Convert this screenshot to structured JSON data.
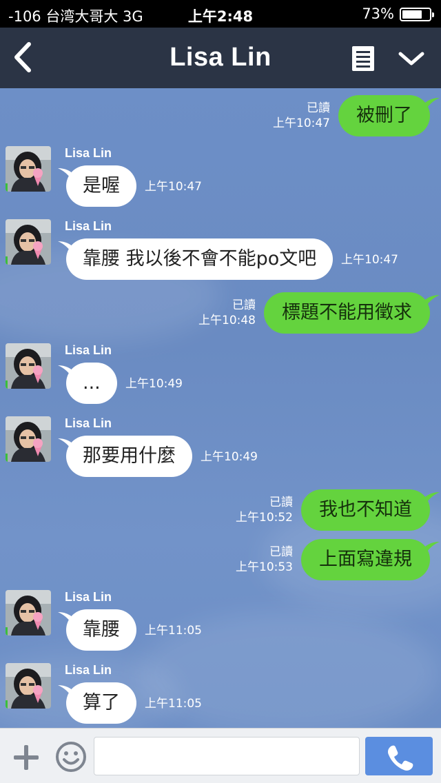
{
  "status_bar": {
    "carrier": "-106 台湾大哥大  3G",
    "time": "上午2:48",
    "battery_percent_text": "73%",
    "battery_level": 0.73
  },
  "header": {
    "title": "Lisa Lin",
    "back_icon": "chevron-left-icon",
    "menu_icon": "list-icon",
    "dropdown_icon": "chevron-down-icon"
  },
  "messages": [
    {
      "direction": "out",
      "text": "被刪了",
      "read": "已讀",
      "time": "上午10:47"
    },
    {
      "direction": "in",
      "sender": "Lisa Lin",
      "text": "是喔",
      "time": "上午10:47"
    },
    {
      "direction": "in",
      "sender": "Lisa Lin",
      "text": "靠腰 我以後不會不能po文吧",
      "time": "上午10:47"
    },
    {
      "direction": "out",
      "text": "標題不能用徵求",
      "read": "已讀",
      "time": "上午10:48"
    },
    {
      "direction": "in",
      "sender": "Lisa Lin",
      "text": "...",
      "time": "上午10:49"
    },
    {
      "direction": "in",
      "sender": "Lisa Lin",
      "text": "那要用什麼",
      "time": "上午10:49"
    },
    {
      "direction": "out",
      "text": "我也不知道",
      "read": "已讀",
      "time": "上午10:52"
    },
    {
      "direction": "out",
      "text": "上面寫違規",
      "read": "已讀",
      "time": "上午10:53"
    },
    {
      "direction": "in",
      "sender": "Lisa Lin",
      "text": "靠腰",
      "time": "上午11:05"
    },
    {
      "direction": "in",
      "sender": "Lisa Lin",
      "text": "算了",
      "time": "上午11:05"
    }
  ],
  "input_bar": {
    "plus_icon": "plus-icon",
    "emoji_icon": "smiley-icon",
    "message_value": "",
    "call_icon": "phone-icon"
  },
  "colors": {
    "header_bg": "#2b3445",
    "chat_bg": "#6d8fc7",
    "outgoing_bubble": "#64d33e",
    "incoming_bubble": "#ffffff",
    "call_button": "#5b8ee0"
  }
}
